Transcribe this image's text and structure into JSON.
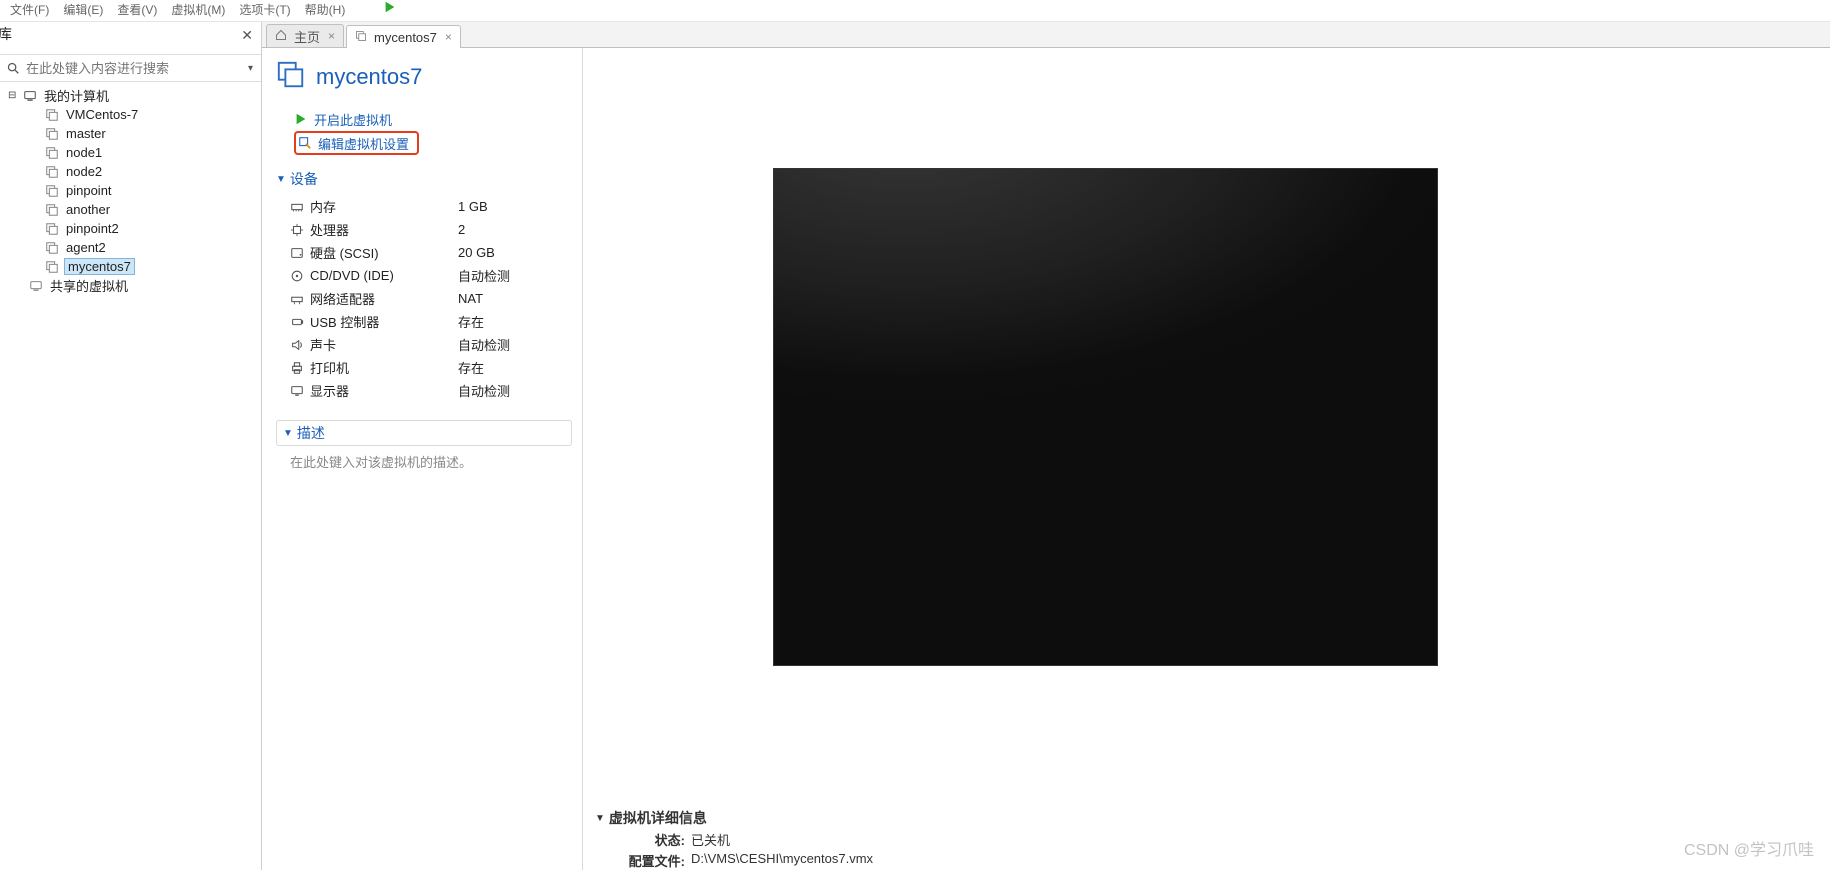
{
  "menu": {
    "file": "文件(F)",
    "edit": "编辑(E)",
    "view": "查看(V)",
    "vm": "虚拟机(M)",
    "tabs": "选项卡(T)",
    "help": "帮助(H)"
  },
  "sidebar": {
    "header_title": "库",
    "search_placeholder": "在此处键入内容进行搜索",
    "root_my_computer": "我的计算机",
    "items": [
      "VMCentos-7",
      "master",
      "node1",
      "node2",
      "pinpoint",
      "another",
      "pinpoint2",
      "agent2",
      "mycentos7"
    ],
    "shared": "共享的虚拟机"
  },
  "tabs": {
    "home": "主页",
    "vm": "mycentos7"
  },
  "vm": {
    "title": "mycentos7",
    "start": "开启此虚拟机",
    "edit": "编辑虚拟机设置"
  },
  "sections": {
    "devices": "设备",
    "description": "描述",
    "desc_placeholder": "在此处键入对该虚拟机的描述。",
    "vm_details": "虚拟机详细信息"
  },
  "devices": [
    {
      "name": "内存",
      "value": "1 GB",
      "icon": "mem"
    },
    {
      "name": "处理器",
      "value": "2",
      "icon": "cpu"
    },
    {
      "name": "硬盘 (SCSI)",
      "value": "20 GB",
      "icon": "hdd"
    },
    {
      "name": "CD/DVD (IDE)",
      "value": "自动检测",
      "icon": "cd"
    },
    {
      "name": "网络适配器",
      "value": "NAT",
      "icon": "net"
    },
    {
      "name": "USB 控制器",
      "value": "存在",
      "icon": "usb"
    },
    {
      "name": "声卡",
      "value": "自动检测",
      "icon": "snd"
    },
    {
      "name": "打印机",
      "value": "存在",
      "icon": "prn"
    },
    {
      "name": "显示器",
      "value": "自动检测",
      "icon": "mon"
    }
  ],
  "details": {
    "status_k": "状态:",
    "status_v": "已关机",
    "config_k": "配置文件:",
    "config_v": "D:\\VMS\\CESHI\\mycentos7.vmx"
  },
  "watermark": "CSDN @学习爪哇"
}
